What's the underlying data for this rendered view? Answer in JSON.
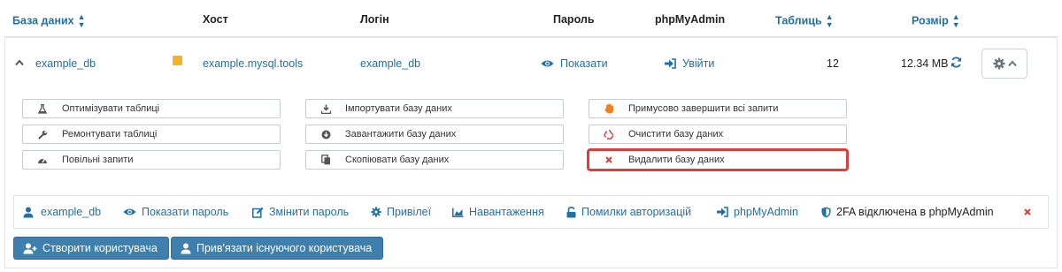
{
  "table": {
    "headers": {
      "database": "База даних",
      "host": "Хост",
      "login": "Логін",
      "password": "Пароль",
      "pma": "phpMyAdmin",
      "tables": "Таблиць",
      "size": "Розмір"
    },
    "row": {
      "db_name": "example_db",
      "host": "example.mysql.tools",
      "login": "example_db",
      "password_action": "Показати",
      "pma_action": "Увійти",
      "tables_count": "12",
      "size": "12.34 MB"
    }
  },
  "actions": {
    "col1": [
      "Оптимізувати таблиці",
      "Ремонтувати таблиці",
      "Повільні запити"
    ],
    "col2": [
      "Імпортувати базу даних",
      "Завантажити базу даних",
      "Скопіювати базу даних"
    ],
    "col3": [
      "Примусово завершити всі запити",
      "Очистити базу даних",
      "Видалити базу даних"
    ]
  },
  "user_bar": {
    "user": "example_db",
    "show_password": "Показати пароль",
    "change_password": "Змінити пароль",
    "privileges": "Привілеї",
    "load": "Навантаження",
    "auth_errors": "Помилки авторизацій",
    "pma": "phpMyAdmin",
    "twofa": "2FA відключена в phpMyAdmin"
  },
  "buttons": {
    "create_user": "Створити користувача",
    "attach_user": "Прив'язати існуючого користувача"
  },
  "colors": {
    "link": "#1f6fa8",
    "button": "#3f7fae",
    "danger": "#d9403b",
    "note": "#f5b324"
  }
}
